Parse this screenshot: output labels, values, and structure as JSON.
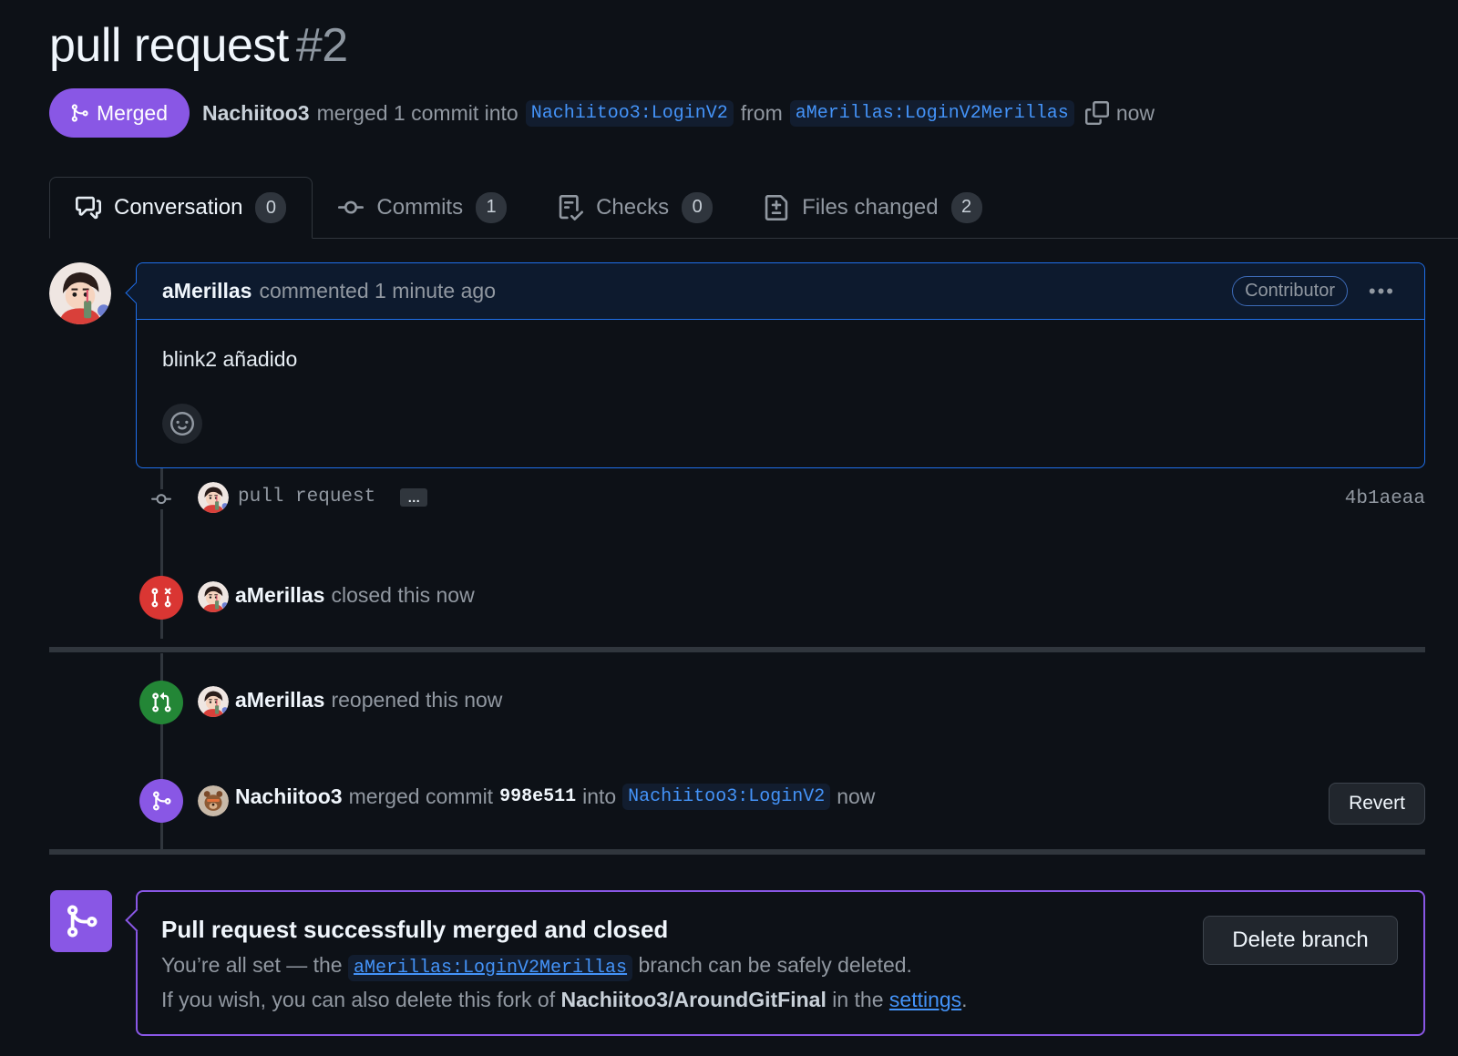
{
  "header": {
    "title": "pull request",
    "number": "#2",
    "status_badge": "Merged",
    "merger": "Nachiitoo3",
    "merge_summary": "merged 1 commit into",
    "base_branch": "Nachiitoo3:LoginV2",
    "from_word": "from",
    "head_branch": "aMerillas:LoginV2Merillas",
    "time": "now"
  },
  "tabs": [
    {
      "label": "Conversation",
      "count": "0",
      "icon": "comment-discussion-icon"
    },
    {
      "label": "Commits",
      "count": "1",
      "icon": "git-commit-icon"
    },
    {
      "label": "Checks",
      "count": "0",
      "icon": "checklist-icon"
    },
    {
      "label": "Files changed",
      "count": "2",
      "icon": "file-diff-icon"
    }
  ],
  "comment": {
    "author": "aMerillas",
    "meta": "commented 1 minute ago",
    "role": "Contributor",
    "body": "blink2 añadido"
  },
  "timeline": {
    "commit": {
      "message": "pull request",
      "expand": "…",
      "sha": "4b1aeaa"
    },
    "closed": {
      "author": "aMerillas",
      "text": "closed this now"
    },
    "reopened": {
      "author": "aMerillas",
      "text": "reopened this now"
    },
    "merged": {
      "author": "Nachiitoo3",
      "text_before": "merged commit",
      "commit": "998e511",
      "text_into": "into",
      "branch": "Nachiitoo3:LoginV2",
      "time": "now",
      "revert_label": "Revert"
    }
  },
  "merge_box": {
    "title": "Pull request successfully merged and closed",
    "line1_before": "You’re all set — the",
    "line1_branch": "aMerillas:LoginV2Merillas",
    "line1_after": "branch can be safely deleted.",
    "line2_before": "If you wish, you can also delete this fork of",
    "line2_repo": "Nachiitoo3/AroundGitFinal",
    "line2_mid": "in the",
    "line2_link": "settings",
    "line2_end": ".",
    "delete_label": "Delete branch"
  },
  "colors": {
    "merged": "#8957e5",
    "closed": "#da3633",
    "reopened": "#238636",
    "link": "#4493f8",
    "background": "#0d1117"
  }
}
